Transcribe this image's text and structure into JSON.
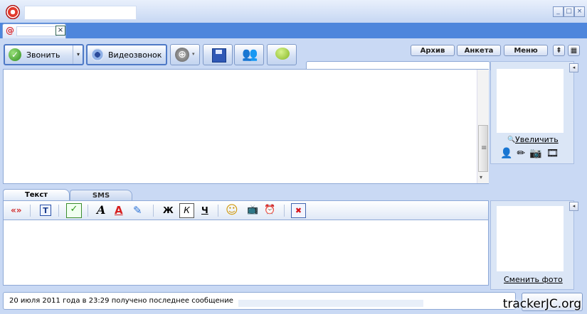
{
  "window": {
    "controls": [
      "_",
      "□",
      "×"
    ]
  },
  "tab": {
    "at_symbol": "@",
    "close": "×"
  },
  "toolbar": {
    "call_label": "Звонить",
    "call_drop": "▾",
    "video_label": "Видеозвонок",
    "globe_glyph": "⊕",
    "globe_drop": "▾",
    "contacts_glyph": "👥"
  },
  "top_right": {
    "archive": "Архив",
    "profile": "Анкета",
    "menu": "Меню",
    "pin": "⇞",
    "grid": "▦"
  },
  "history": {
    "scroll_grip": "≡",
    "scroll_down": "▾"
  },
  "avatar_panel": {
    "zoom_icon": "🔍",
    "zoom_label": "Увеличить",
    "icons": "👤✏📷🎞",
    "collapse": "◂"
  },
  "input_tabs": {
    "text": "Текст",
    "sms": "SMS"
  },
  "format_toolbar": {
    "quotes": "«»",
    "translit": "T",
    "spell": "✓",
    "font": "A",
    "color": "A",
    "highlight": "✎",
    "bold": "Ж",
    "italic": "К",
    "underline": "Ч",
    "smile": "☺",
    "tv": "📺",
    "clock": "⏰",
    "clear": "✖"
  },
  "photo_panel": {
    "change_label": "Сменить фото",
    "collapse": "◂"
  },
  "status": {
    "message": "20 июля 2011 года в 23:29 получено последнее сообщение"
  },
  "watermark": "trackerJC.org"
}
